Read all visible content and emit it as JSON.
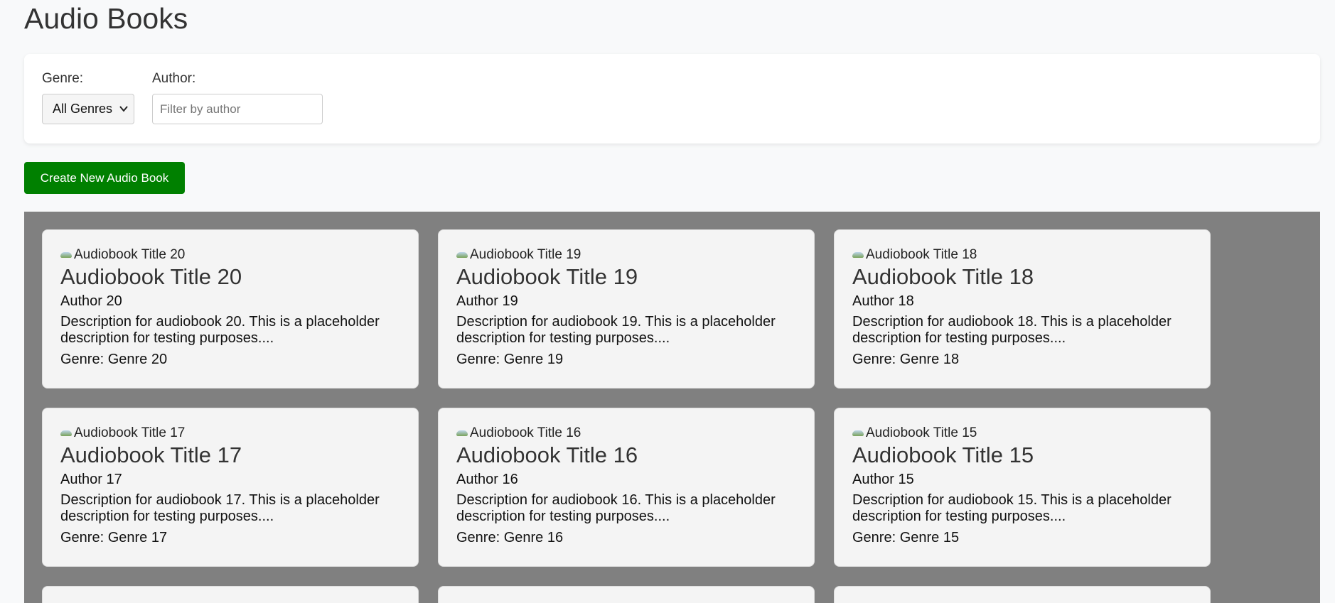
{
  "page": {
    "title": "Audio Books"
  },
  "filters": {
    "genre_label": "Genre:",
    "genre_selected": "All Genres",
    "author_label": "Author:",
    "author_value": "",
    "author_placeholder": "Filter by author"
  },
  "actions": {
    "create_label": "Create New Audio Book"
  },
  "colors": {
    "create_button": "#008000",
    "grid_background": "#808080",
    "card_background": "#f4f4f4"
  },
  "books": [
    {
      "image_alt": "Audiobook Title 20",
      "title": "Audiobook Title 20",
      "author": "Author 20",
      "description": "Description for audiobook 20. This is a placeholder description for testing purposes....",
      "genre": "Genre: Genre 20"
    },
    {
      "image_alt": "Audiobook Title 19",
      "title": "Audiobook Title 19",
      "author": "Author 19",
      "description": "Description for audiobook 19. This is a placeholder description for testing purposes....",
      "genre": "Genre: Genre 19"
    },
    {
      "image_alt": "Audiobook Title 18",
      "title": "Audiobook Title 18",
      "author": "Author 18",
      "description": "Description for audiobook 18. This is a placeholder description for testing purposes....",
      "genre": "Genre: Genre 18"
    },
    {
      "image_alt": "Audiobook Title 17",
      "title": "Audiobook Title 17",
      "author": "Author 17",
      "description": "Description for audiobook 17. This is a placeholder description for testing purposes....",
      "genre": "Genre: Genre 17"
    },
    {
      "image_alt": "Audiobook Title 16",
      "title": "Audiobook Title 16",
      "author": "Author 16",
      "description": "Description for audiobook 16. This is a placeholder description for testing purposes....",
      "genre": "Genre: Genre 16"
    },
    {
      "image_alt": "Audiobook Title 15",
      "title": "Audiobook Title 15",
      "author": "Author 15",
      "description": "Description for audiobook 15. This is a placeholder description for testing purposes....",
      "genre": "Genre: Genre 15"
    }
  ]
}
